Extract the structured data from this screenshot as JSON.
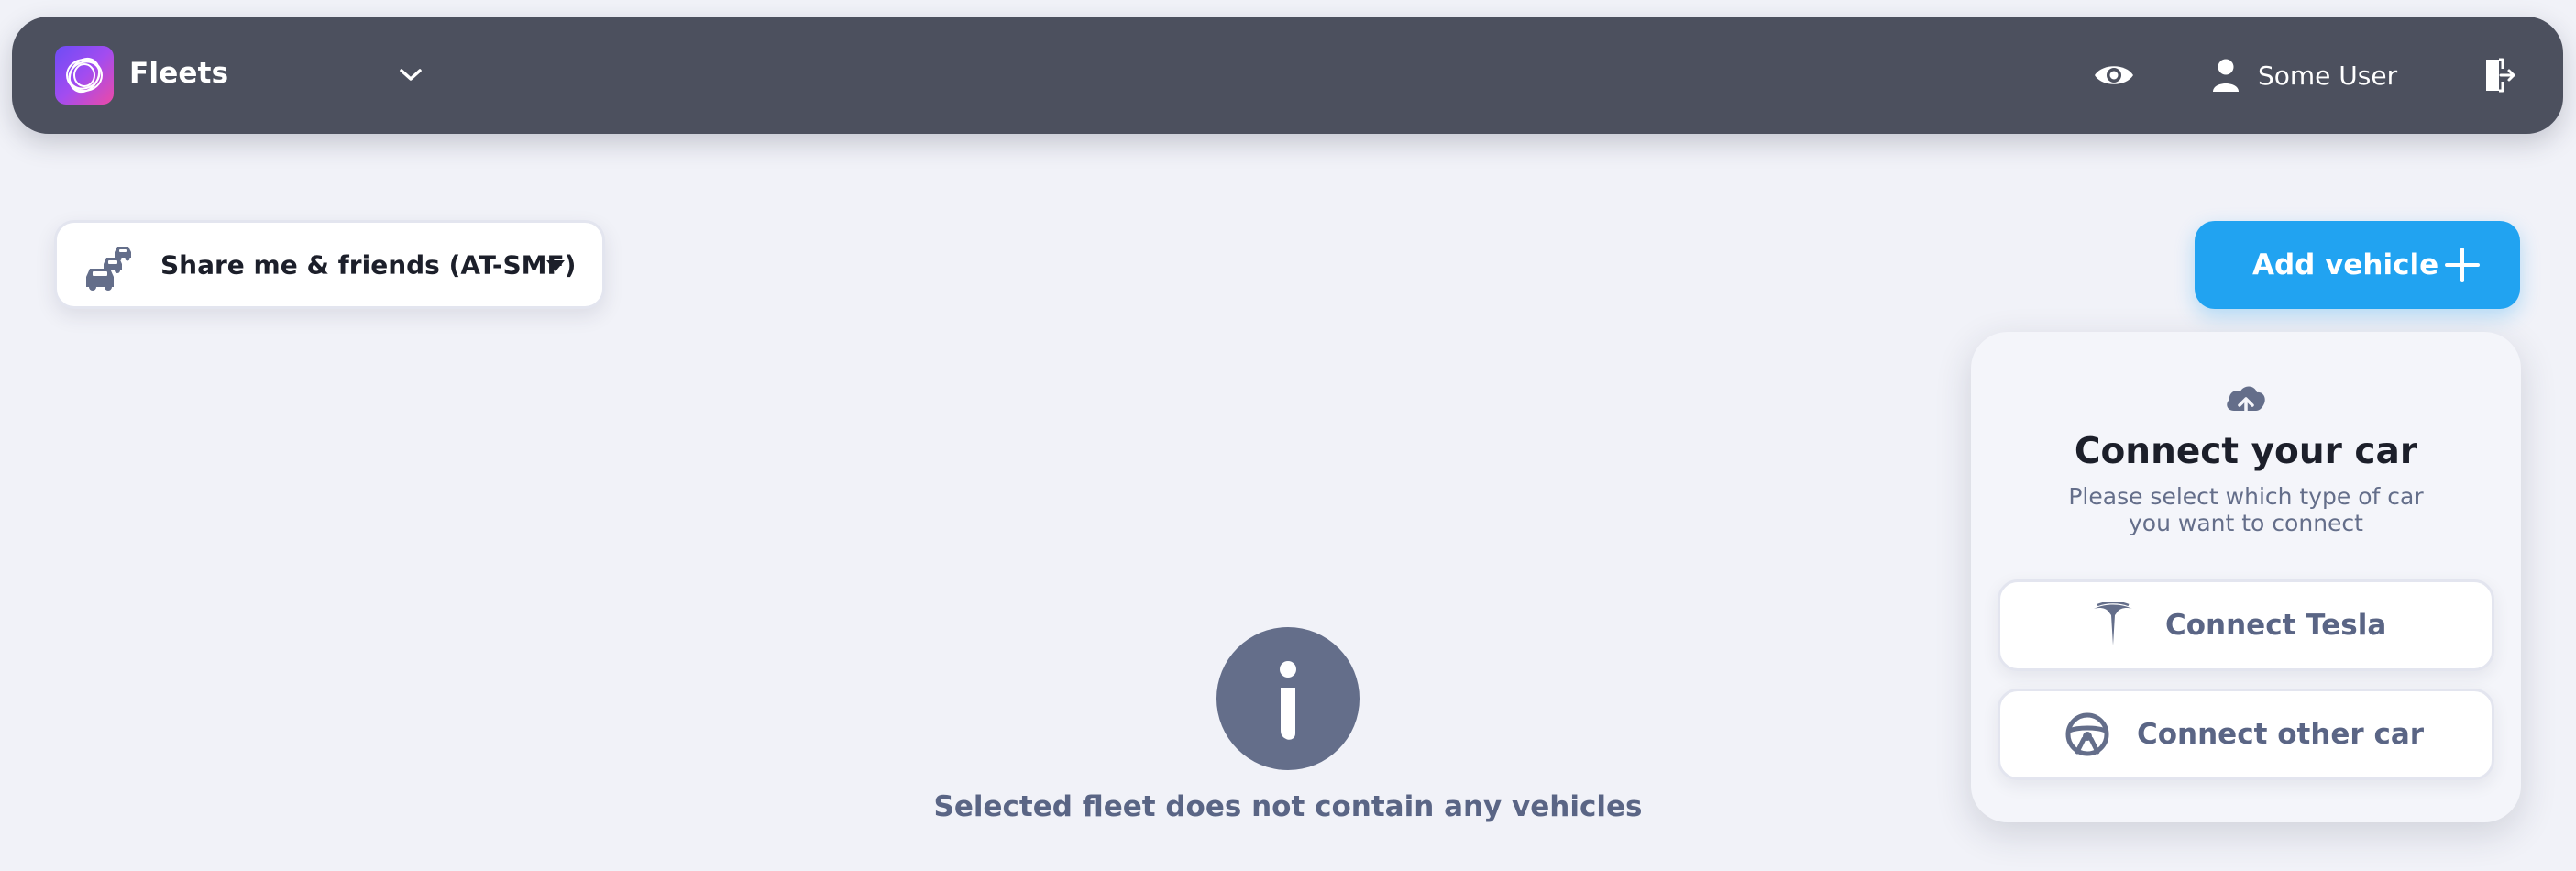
{
  "header": {
    "app_title": "Fleets",
    "icons": {
      "logo": "app-logo",
      "fleet_switch": "chevron-down-icon",
      "visibility": "eye-icon",
      "user": "user-icon",
      "logout": "logout-icon"
    },
    "user_name": "Some User"
  },
  "fleet_select": {
    "value": "Share me & friends (AT-SMF)",
    "icon": "cars-icon"
  },
  "add_vehicle": {
    "label": "Add vehicle",
    "icon": "plus-icon"
  },
  "connect_panel": {
    "icon": "cloud-upload-icon",
    "title": "Connect your car",
    "subtitle": "Please select which type of car you want to connect",
    "options": [
      {
        "label": "Connect Tesla",
        "icon": "tesla-icon"
      },
      {
        "label": "Connect other car",
        "icon": "steering-wheel-icon"
      }
    ]
  },
  "empty_state": {
    "icon": "info-icon",
    "message": "Selected fleet does not contain any vehicles"
  },
  "colors": {
    "background": "#f1f2f8",
    "header": "#4c505e",
    "accent": "#21a3f1",
    "muted": "#646e8a",
    "text": "#1c1f2a"
  }
}
